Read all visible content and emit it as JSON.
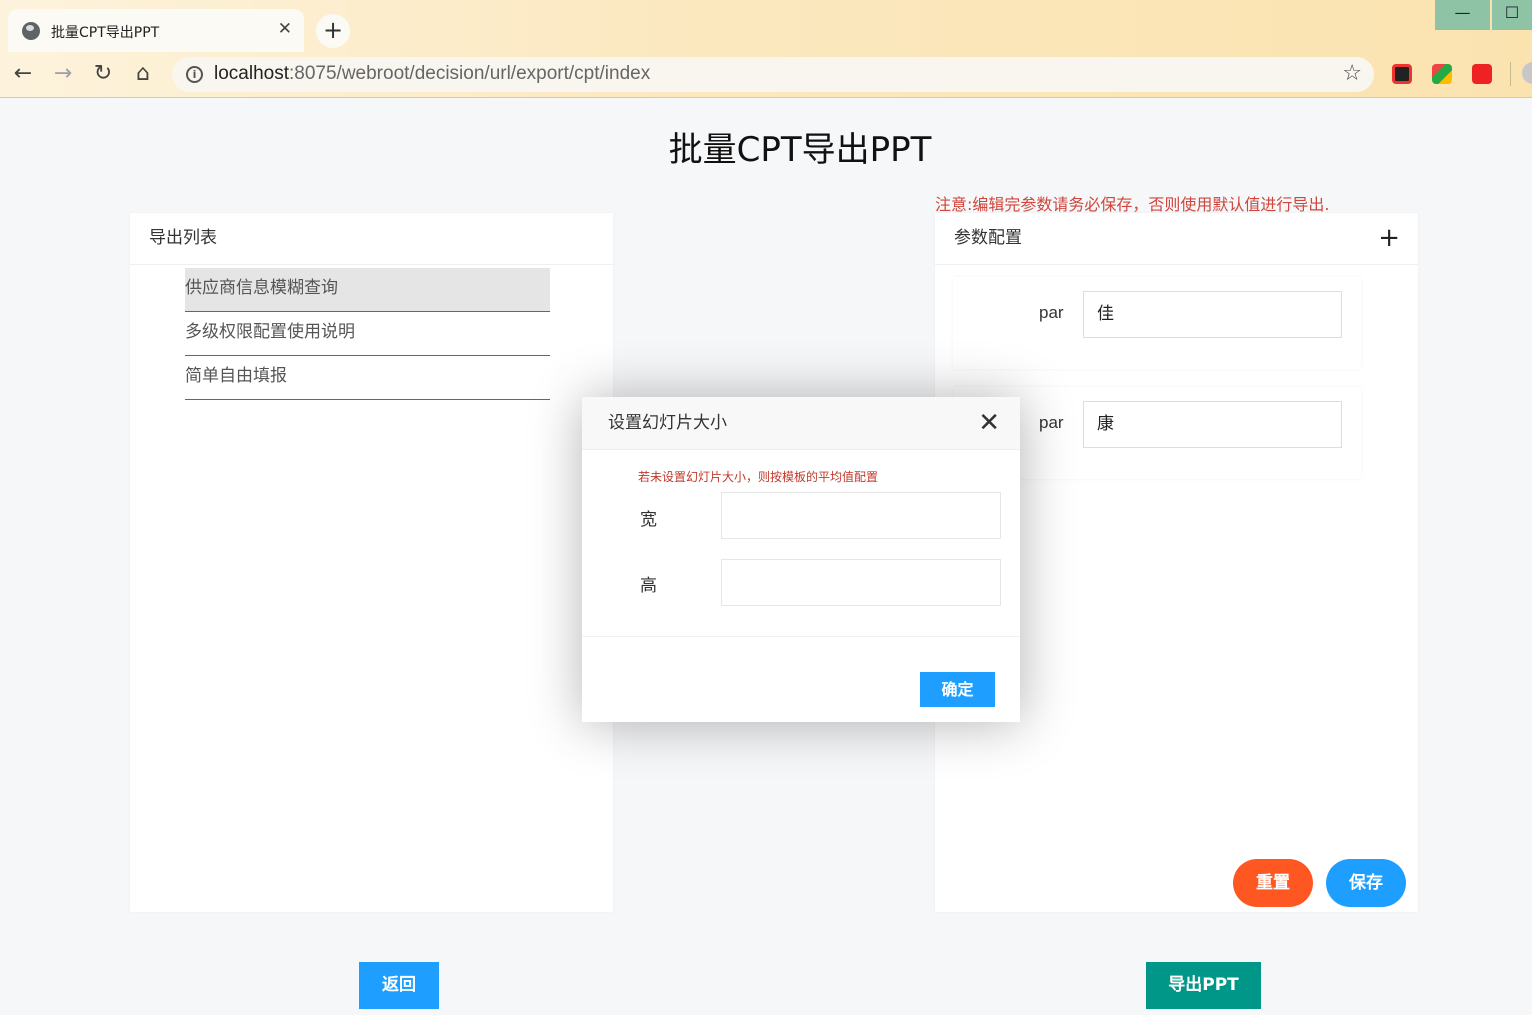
{
  "browser": {
    "tab_title": "批量CPT导出PPT",
    "tab_close": "✕",
    "new_tab": "+",
    "url_host": "localhost",
    "url_path": ":8075/webroot/decision/url/export/cpt/index",
    "win_min": "—",
    "win_max": "☐",
    "icons": {
      "back": "←",
      "forward": "→",
      "reload": "↻",
      "home": "⌂",
      "star": "☆",
      "info": "i"
    }
  },
  "page": {
    "title": "批量CPT导出PPT",
    "notice": "注意:编辑完参数请务必保存，否则使用默认值进行导出.",
    "notice_color": "#d0463c"
  },
  "export_list": {
    "header": "导出列表",
    "items": [
      {
        "label": "供应商信息模糊查询",
        "selected": true
      },
      {
        "label": "多级权限配置使用说明",
        "selected": false
      },
      {
        "label": "简单自由填报",
        "selected": false
      }
    ]
  },
  "param_config": {
    "header": "参数配置",
    "add_icon": "+",
    "params": [
      {
        "label": "par",
        "value": "佳"
      },
      {
        "label": "par",
        "value": "康"
      }
    ],
    "reset_label": "重置",
    "save_label": "保存"
  },
  "footer": {
    "back_label": "返回",
    "export_label": "导出PPT"
  },
  "dialog": {
    "title": "设置幻灯片大小",
    "close_icon": "✕",
    "tip": "若未设置幻灯片大小，则按模板的平均值配置",
    "width_label": "宽",
    "height_label": "高",
    "width_value": "",
    "height_value": "",
    "confirm_label": "确定"
  },
  "colors": {
    "primary_blue": "#1e9fff",
    "reset_orange": "#ff5722",
    "export_teal": "#009688"
  }
}
